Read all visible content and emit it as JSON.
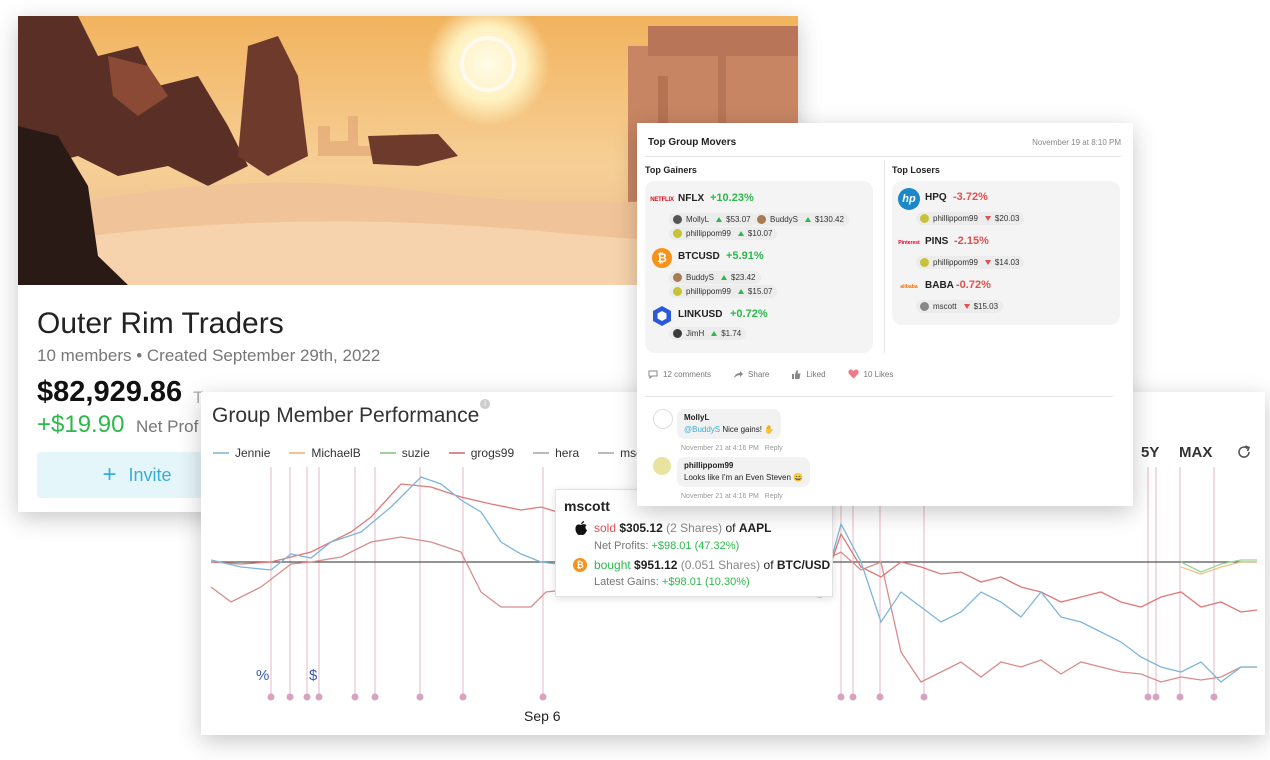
{
  "group": {
    "name": "Outer Rim Traders",
    "subtitle": "10 members • Created September 29th, 2022",
    "total_value": "$82,929.86",
    "total_label": "T",
    "net_profit": "+$19.90",
    "net_profit_label": "Net Prof",
    "invite_label": "Invite"
  },
  "performance": {
    "title": "Group Member Performance",
    "legend": [
      {
        "name": "Jennie",
        "color": "#9ec4e0"
      },
      {
        "name": "MichaelB",
        "color": "#f0c48a"
      },
      {
        "name": "suzie",
        "color": "#9dd49c"
      },
      {
        "name": "grogs99",
        "color": "#e08a8a"
      },
      {
        "name": "hera",
        "color": "#bbbbbb"
      },
      {
        "name": "mscott",
        "color": "#bbbbbb"
      }
    ],
    "ranges": [
      "5Y",
      "MAX"
    ],
    "pct_marker": "%",
    "dollar_marker": "$",
    "date_label": "Sep 6"
  },
  "tooltip": {
    "user": "mscott",
    "trade1": {
      "action": "sold",
      "amount": "$305.12",
      "shares": "(2 Shares)",
      "of": "of",
      "ticker": "AAPL"
    },
    "trade1_sub": {
      "label": "Net Profits:",
      "value": "+$98.01 (47.32%)"
    },
    "trade2": {
      "action": "bought",
      "amount": "$951.12",
      "shares": "(0.051 Shares)",
      "of": "of",
      "ticker": "BTC/USD"
    },
    "trade2_sub": {
      "label": "Latest Gains:",
      "value": "+$98.01 (10.30%)"
    }
  },
  "movers": {
    "title": "Top Group Movers",
    "timestamp": "November 19 at 8:10 PM",
    "gainers_heading": "Top Gainers",
    "losers_heading": "Top Losers",
    "gainers": [
      {
        "ticker": "NFLX",
        "change": "+10.23%",
        "logo": "NETFLIX",
        "holders": [
          {
            "name": "MollyL",
            "value": "$53.07"
          },
          {
            "name": "BuddyS",
            "value": "$130.42"
          },
          {
            "name": "phillippom99",
            "value": "$10.07"
          }
        ]
      },
      {
        "ticker": "BTCUSD",
        "change": "+5.91%",
        "logo": "₿",
        "holders": [
          {
            "name": "BuddyS",
            "value": "$23.42"
          },
          {
            "name": "phillippom99",
            "value": "$15.07"
          }
        ]
      },
      {
        "ticker": "LINKUSD",
        "change": "+0.72%",
        "logo": "link",
        "holders": [
          {
            "name": "JimH",
            "value": "$1.74"
          }
        ]
      }
    ],
    "losers": [
      {
        "ticker": "HPQ",
        "change": "-3.72%",
        "logo": "hp",
        "holders": [
          {
            "name": "phillippom99",
            "value": "$20.03"
          }
        ]
      },
      {
        "ticker": "PINS",
        "change": "-2.15%",
        "logo": "Pinterest",
        "holders": [
          {
            "name": "phillippom99",
            "value": "$14.03"
          }
        ]
      },
      {
        "ticker": "BABA",
        "change": "-0.72%",
        "logo": "alibaba",
        "holders": [
          {
            "name": "mscott",
            "value": "$15.03"
          }
        ]
      }
    ],
    "actions": {
      "comments": "12 comments",
      "share": "Share",
      "liked": "Liked",
      "likes": "10 Likes"
    },
    "comments": [
      {
        "author": "MollyL",
        "mention": "@BuddyS",
        "text": " Nice gains! ✋",
        "time": "November 21 at 4:16 PM",
        "reply": "Reply"
      },
      {
        "author": "phillippom99",
        "text": "Looks like I'm an Even Steven 😄",
        "time": "November 21 at 4:16 PM",
        "reply": "Reply"
      }
    ]
  }
}
